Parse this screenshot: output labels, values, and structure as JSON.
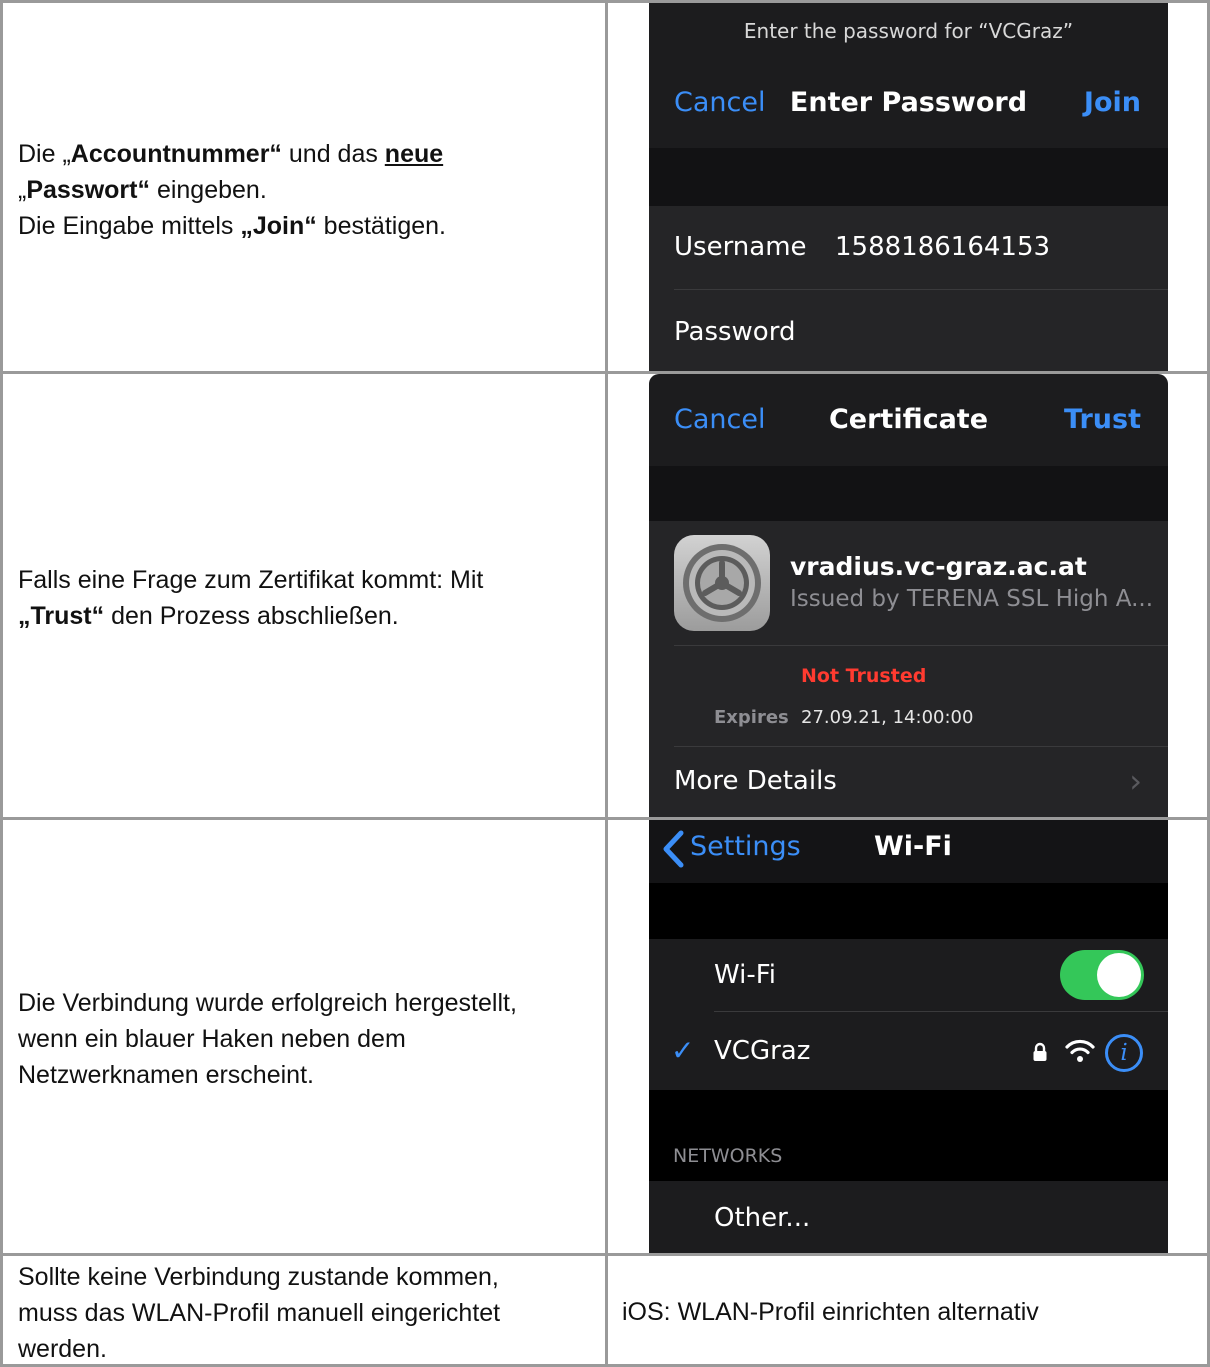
{
  "row1": {
    "text": {
      "p1": "Die „",
      "b1": "Accountnummer“",
      "p2": " und das ",
      "u1": "neue",
      "p3": "„",
      "b2": "Passwort“",
      "p4": " eingeben.",
      "p5": "Die Eingabe mittels ",
      "b3": "„Join“",
      "p6": " bestätigen."
    },
    "screen": {
      "prompt": "Enter the password for “VCGraz”",
      "cancel": "Cancel",
      "title": "Enter Password",
      "join": "Join",
      "username_label": "Username",
      "username_value": "1588186164153",
      "password_label": "Password"
    }
  },
  "row2": {
    "text": {
      "p1": "Falls eine Frage zum Zertifikat kommt: Mit",
      "b1": "„Trust“",
      "p2": " den Prozess abschließen."
    },
    "screen": {
      "cancel": "Cancel",
      "title": "Certificate",
      "trust": "Trust",
      "host": "vradius.vc-graz.ac.at",
      "issuer": "Issued by TERENA SSL High A...",
      "status": "Not Trusted",
      "expires_label": "Expires",
      "expires_value": "27.09.21, 14:00:00",
      "more_details": "More Details",
      "chevron": "›"
    }
  },
  "row3": {
    "text": {
      "line1": "Die Verbindung wurde erfolgreich hergestellt,",
      "line2": "wenn ein blauer Haken neben dem",
      "line3": "Netzwerknamen erscheint."
    },
    "screen": {
      "back": "Settings",
      "title": "Wi-Fi",
      "wifi_label": "Wi-Fi",
      "wifi_on": true,
      "check": "✓",
      "network": "VCGraz",
      "info": "i",
      "networks_header": "NETWORKS",
      "other": "Other..."
    }
  },
  "row4": {
    "text": {
      "line1": "Sollte keine Verbindung zustande kommen,",
      "line2": "muss das WLAN-Profil manuell eingerichtet",
      "line3": "werden."
    },
    "link": "iOS: WLAN-Profil einrichten alternativ"
  },
  "colors": {
    "accent_blue": "#3b8ef7",
    "not_trusted_red": "#ff3b30",
    "toggle_green": "#34c759",
    "ios_dark": "#1c1c1e"
  },
  "icons": [
    "gear-icon",
    "lock-icon",
    "wifi-icon",
    "info-icon",
    "chevron-left-icon",
    "chevron-right-icon",
    "checkmark-icon"
  ]
}
